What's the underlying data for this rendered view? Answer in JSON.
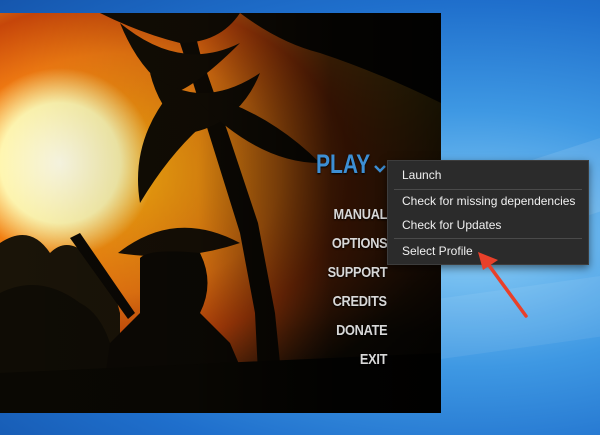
{
  "desktop": {
    "background": "#2a7fd6"
  },
  "game": {
    "menu": {
      "play_label": "PLAY",
      "items": [
        "MANUAL",
        "OPTIONS",
        "SUPPORT",
        "CREDITS",
        "DONATE",
        "EXIT"
      ],
      "play_color": "#3d8fd4"
    },
    "context_menu": {
      "items": [
        "Launch",
        "Check for missing dependencies",
        "Check for Updates",
        "Select Profile"
      ],
      "highlighted": "Select Profile"
    }
  },
  "annotation": {
    "arrow_color": "#e8402a",
    "arrow_icon": "red-arrow-icon"
  }
}
